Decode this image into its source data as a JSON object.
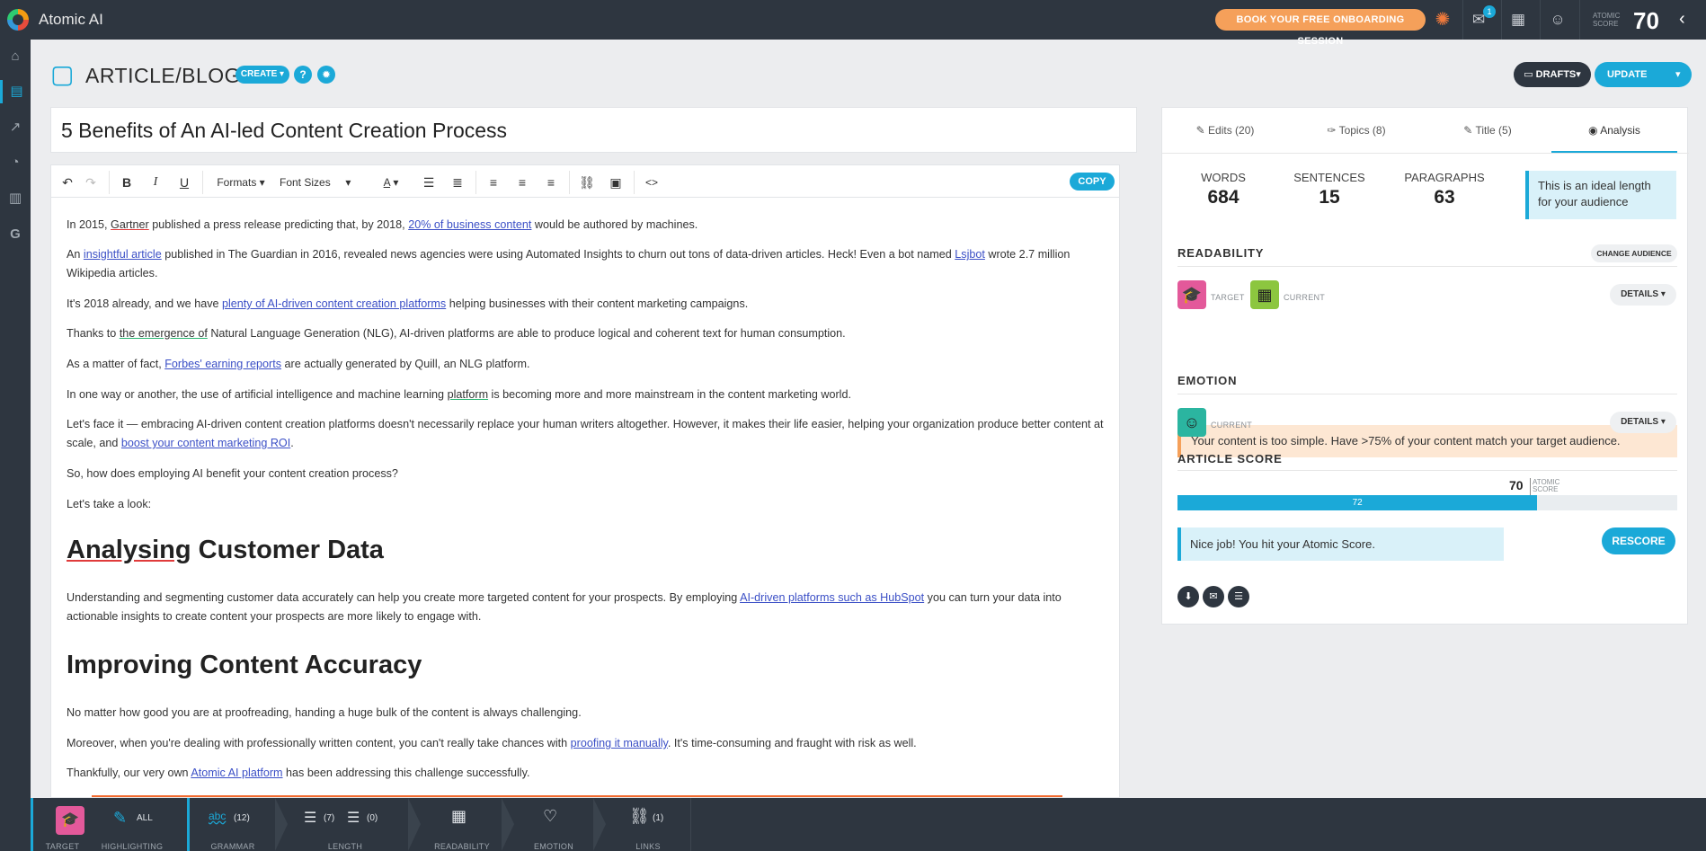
{
  "app": {
    "title": "Atomic AI",
    "brand_color": "#1ba9d8",
    "dark_color": "#2e3640"
  },
  "topbar": {
    "onboarding_label": "BOOK YOUR FREE ONBOARDING SESSION",
    "notification_count": "1",
    "score_label_line1": "ATOMIC",
    "score_label_line2": "SCORE",
    "score_value": "70",
    "icons": [
      "hubspot-icon",
      "notification-icon",
      "calendar-icon",
      "user-icon",
      "collapse-icon"
    ]
  },
  "sidebar": {
    "items": [
      "home-icon",
      "document-icon",
      "export-icon",
      "history-icon",
      "chart-icon",
      "google-icon"
    ],
    "active_index": 1
  },
  "header": {
    "page_title": "ARTICLE/BLOG",
    "create_label": "CREATE",
    "help_label": "?",
    "drafts_label": "DRAFTS",
    "update_label": "UPDATE"
  },
  "editor": {
    "title": "5 Benefits of An AI-led Content Creation Process",
    "toolbar": {
      "formats_label": "Formats",
      "font_sizes_label": "Font Sizes",
      "copy_label": "COPY"
    },
    "paragraphs": {
      "p1a": "In 2015, ",
      "p1b": "Gartner",
      "p1c": " published a press release predicting that, by 2018, ",
      "p1d": "20% of business content",
      "p1e": " would be authored by machines.",
      "p2a": "An ",
      "p2b": "insightful article",
      "p2c": " published in The Guardian in 2016, revealed news agencies were using Automated Insights to churn out tons of data-driven articles. Heck! Even a bot named ",
      "p2d": "Lsjbot",
      "p2e": " wrote 2.7 million Wikipedia articles.",
      "p3a": "It's 2018 already, and we have ",
      "p3b": "plenty of AI-driven content creation platforms",
      "p3c": " helping businesses with their content marketing campaigns.",
      "p4a": "Thanks to ",
      "p4b": "the emergence of",
      "p4c": " Natural Language Generation (NLG), AI-driven platforms are able to produce logical and coherent text for human consumption.",
      "p5a": "As a matter of fact, ",
      "p5b": "Forbes' earning reports",
      "p5c": " are actually generated by Quill, an NLG platform.",
      "p6a": "In one way or another, the use of artificial intelligence and machine learning ",
      "p6b": "platform",
      "p6c": " is becoming more and more mainstream in the content marketing world.",
      "p7a": "Let's face it — embracing AI-driven content creation platforms doesn't necessarily replace your human writers altogether. However, it makes their life easier, helping your organization produce better content at scale, and ",
      "p7b": "boost your content marketing ROI",
      "p7c": ".",
      "p8": "So, how does employing AI benefit your content creation process?",
      "p9": "Let's take a look:",
      "h1a": "Analysing",
      "h1b": " Customer Data",
      "p10a": "Understanding and segmenting customer data accurately can help you create more targeted content for your prospects. By employing ",
      "p10b": "AI-driven platforms such as HubSpot",
      "p10c": " you can turn your data into actionable insights to create content your prospects are more likely to engage with.",
      "h2": "Improving Content Accuracy",
      "p11": "No matter how good you are at proofreading, handing a huge bulk of the content is always challenging.",
      "p12a": "Moreover, when you're dealing with professionally written content, you can't really take chances with ",
      "p12b": "proofing it manually",
      "p12c": ". It's time-consuming and fraught with risk as well.",
      "p13a": "Thankfully, our very own ",
      "p13b": "Atomic AI platform",
      "p13c": " has been addressing this challenge successfully."
    }
  },
  "panel": {
    "tabs": [
      "Edits (20)",
      "Topics (8)",
      "Title (5)",
      "Analysis"
    ],
    "active_tab": 3,
    "stats": [
      {
        "label": "WORDS",
        "value": "684"
      },
      {
        "label": "SENTENCES",
        "value": "15"
      },
      {
        "label": "PARAGRAPHS",
        "value": "63"
      }
    ],
    "ideal_text": "This is an ideal length for your audience",
    "readability": {
      "title": "READABILITY",
      "change_audience": "CHANGE AUDIENCE",
      "target_label": "TARGET",
      "current_label": "CURRENT",
      "details_label": "DETAILS",
      "warning": "Your content is too simple. Have >75% of your content match your target audience."
    },
    "emotion": {
      "title": "EMOTION",
      "current_label": "CURRENT",
      "details_label": "DETAILS"
    },
    "article_score": {
      "title": "ARTICLE SCORE",
      "target_value": "70",
      "target_label_line1": "ATOMIC",
      "target_label_line2": "SCORE",
      "current_value": "72",
      "fill_fraction": 0.72,
      "message": "Nice job! You hit your Atomic Score.",
      "rescore_label": "RESCORE"
    }
  },
  "bottombar": {
    "items": [
      {
        "label": "TARGET",
        "count": ""
      },
      {
        "label": "HIGHLIGHTING",
        "count": "ALL"
      },
      {
        "label": "GRAMMAR",
        "count": "(12)"
      },
      {
        "label": "LENGTH",
        "count": "(7)",
        "count2": "(0)"
      },
      {
        "label": "READABILITY",
        "count": ""
      },
      {
        "label": "EMOTION",
        "count": ""
      },
      {
        "label": "LINKS",
        "count": "(1)"
      }
    ]
  }
}
